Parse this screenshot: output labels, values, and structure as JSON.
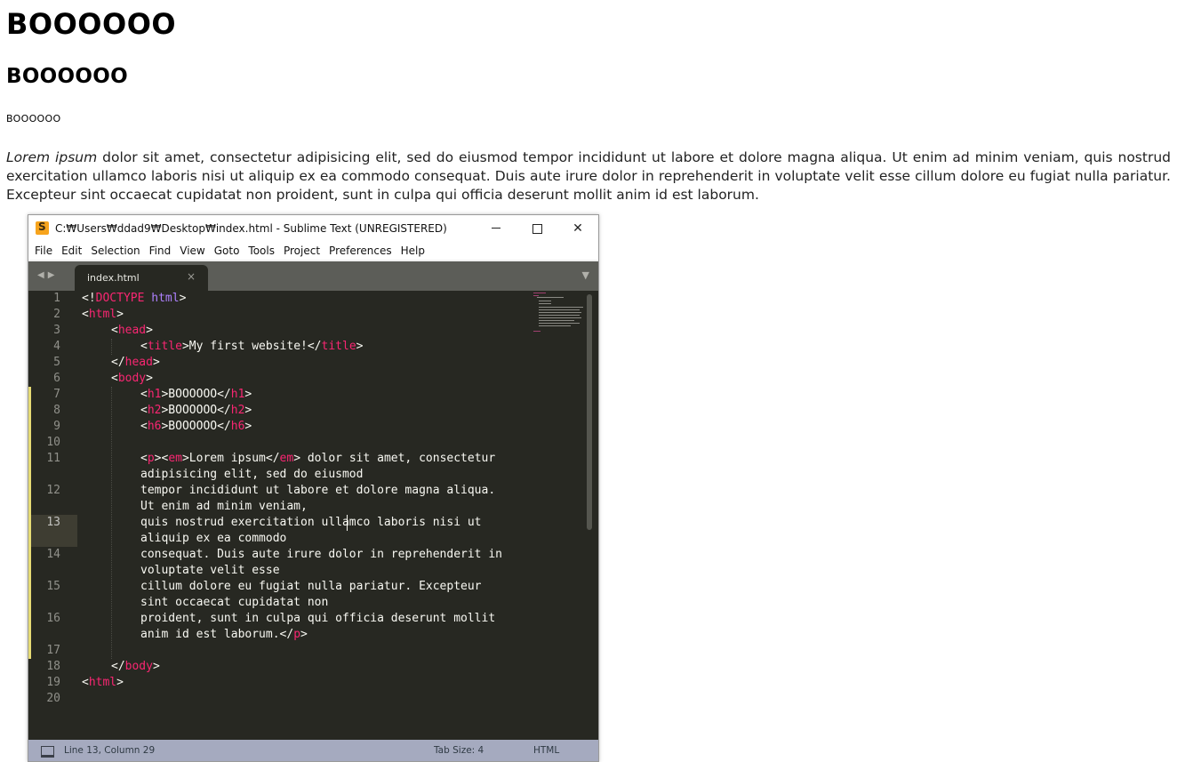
{
  "page": {
    "h1": "BOOOOOO",
    "h2": "BOOOOOO",
    "h6": "BOOOOOO",
    "para_em": "Lorem ipsum",
    "para_rest": " dolor sit amet, consectetur adipisicing elit, sed do eiusmod tempor incididunt ut labore et dolore magna aliqua. Ut enim ad minim veniam, quis nostrud exercitation ullamco laboris nisi ut aliquip ex ea commodo consequat. Duis aute irure dolor in reprehenderit in voluptate velit esse cillum dolore eu fugiat nulla pariatur. Excepteur sint occaecat cupidatat non proident, sunt in culpa qui officia deserunt mollit anim id est laborum."
  },
  "window": {
    "logo_letter": "S",
    "title": "C:₩Users₩ddad9₩Desktop₩index.html - Sublime Text (UNREGISTERED)",
    "minimize_glyph": "",
    "close_glyph": "✕",
    "menu": [
      "File",
      "Edit",
      "Selection",
      "Find",
      "View",
      "Goto",
      "Tools",
      "Project",
      "Preferences",
      "Help"
    ],
    "nav_arrows": "◀▶",
    "tab_label": "index.html",
    "tab_close": "×",
    "tab_dropdown": "▼"
  },
  "editor": {
    "line_numbers": [
      "1",
      "2",
      "3",
      "4",
      "5",
      "6",
      "7",
      "8",
      "9",
      "10",
      "11",
      "12",
      "13",
      "14",
      "15",
      "16",
      "17",
      "18",
      "19",
      "20"
    ],
    "current_line": "13",
    "code": {
      "l1_a": "<!",
      "l1_b": "DOCTYPE",
      "l1_c": " ",
      "l1_d": "html",
      "l1_e": ">",
      "l2_a": "<",
      "l2_b": "html",
      "l2_c": ">",
      "l3_a": "<",
      "l3_b": "head",
      "l3_c": ">",
      "l4_a": "<",
      "l4_b": "title",
      "l4_c": ">My first website!</",
      "l4_d": "title",
      "l4_e": ">",
      "l5_a": "</",
      "l5_b": "head",
      "l5_c": ">",
      "l6_a": "<",
      "l6_b": "body",
      "l6_c": ">",
      "l7_a": "<",
      "l7_b": "h1",
      "l7_c": ">BOOOOOO</",
      "l7_d": "h1",
      "l7_e": ">",
      "l8_a": "<",
      "l8_b": "h2",
      "l8_c": ">BOOOOOO</",
      "l8_d": "h2",
      "l8_e": ">",
      "l9_a": "<",
      "l9_b": "h6",
      "l9_c": ">BOOOOOO</",
      "l9_d": "h6",
      "l9_e": ">",
      "l11_a": "<",
      "l11_b": "p",
      "l11_c": "><",
      "l11_d": "em",
      "l11_e": ">Lorem ipsum</",
      "l11_f": "em",
      "l11_g": "> dolor sit amet, consectetur",
      "l11_w": "adipisicing elit, sed do eiusmod",
      "l12": "tempor incididunt ut labore et dolore magna aliqua.",
      "l12_w": "Ut enim ad minim veniam,",
      "l13": "quis nostrud exercitation ullamco laboris nisi ut",
      "l13_w": "aliquip ex ea commodo",
      "l14": "consequat. Duis aute irure dolor in reprehenderit in",
      "l14_w": "voluptate velit esse",
      "l15": "cillum dolore eu fugiat nulla pariatur. Excepteur",
      "l15_w": "sint occaecat cupidatat non",
      "l16": "proident, sunt in culpa qui officia deserunt mollit",
      "l16_w_a": "anim id est laborum.</",
      "l16_w_b": "p",
      "l16_w_c": ">",
      "l18_a": "</",
      "l18_b": "body",
      "l18_c": ">",
      "l19_a": "<",
      "l19_b": "html",
      "l19_c": ">"
    }
  },
  "status": {
    "position": "Line 13, Column 29",
    "tab_size": "Tab Size: 4",
    "syntax": "HTML"
  },
  "colors": {
    "editor_bg": "#272822",
    "tag_color": "#f92672",
    "keyword_color": "#ae81ff",
    "text_color": "#f8f8f2",
    "status_bar_bg": "#a5aabf",
    "modified_marker": "#e6db74"
  }
}
